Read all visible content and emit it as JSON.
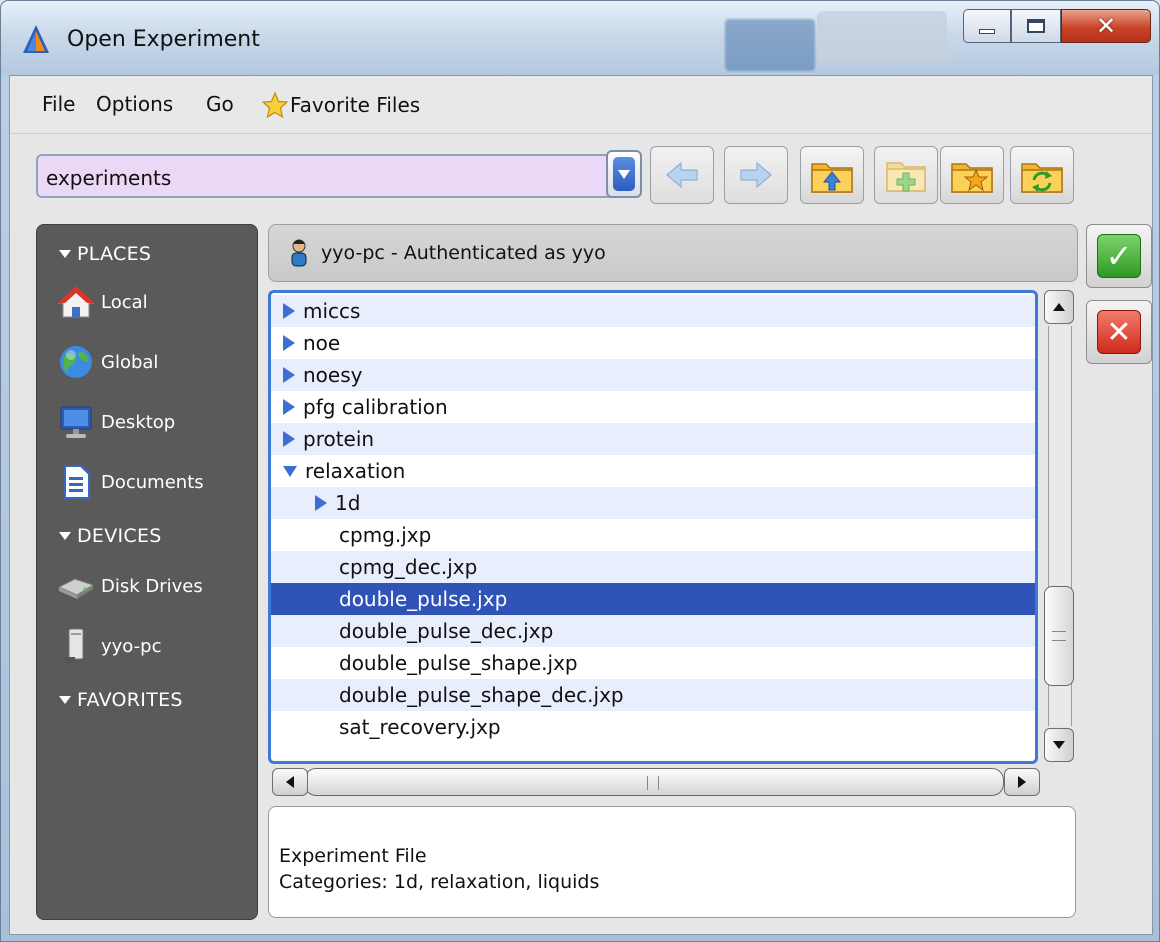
{
  "window": {
    "title": "Open Experiment",
    "accent_color": "#3f78d8",
    "selection_color": "#2f53b6",
    "path_bg_color": "#ead8f6"
  },
  "menu": {
    "file": "File",
    "options": "Options",
    "go": "Go",
    "favorite_files": "Favorite Files"
  },
  "toolbar": {
    "path_value": "experiments",
    "icons": [
      "dropdown-icon",
      "back-arrow-icon",
      "forward-arrow-icon",
      "folder-up-icon",
      "new-folder-icon",
      "favorite-folder-icon",
      "refresh-folder-icon"
    ]
  },
  "sidebar": {
    "places_header": "PLACES",
    "places": [
      {
        "label": "Local",
        "icon": "home-icon"
      },
      {
        "label": "Global",
        "icon": "globe-icon"
      },
      {
        "label": "Desktop",
        "icon": "monitor-icon"
      },
      {
        "label": "Documents",
        "icon": "document-icon"
      }
    ],
    "devices_header": "DEVICES",
    "devices": [
      {
        "label": "Disk Drives",
        "icon": "disk-drive-icon"
      },
      {
        "label": "yyo-pc",
        "icon": "computer-tower-icon"
      }
    ],
    "favorites_header": "FAVORITES"
  },
  "host": {
    "label": "yyo-pc - Authenticated as yyo"
  },
  "files": [
    {
      "name": "miccs",
      "type": "folder",
      "expanded": false,
      "depth": 0
    },
    {
      "name": "noe",
      "type": "folder",
      "expanded": false,
      "depth": 0
    },
    {
      "name": "noesy",
      "type": "folder",
      "expanded": false,
      "depth": 0
    },
    {
      "name": "pfg calibration",
      "type": "folder",
      "expanded": false,
      "depth": 0
    },
    {
      "name": "protein",
      "type": "folder",
      "expanded": false,
      "depth": 0
    },
    {
      "name": "relaxation",
      "type": "folder",
      "expanded": true,
      "depth": 0
    },
    {
      "name": "1d",
      "type": "folder",
      "expanded": false,
      "depth": 1
    },
    {
      "name": "cpmg.jxp",
      "type": "file",
      "depth": 1
    },
    {
      "name": "cpmg_dec.jxp",
      "type": "file",
      "depth": 1
    },
    {
      "name": "double_pulse.jxp",
      "type": "file",
      "depth": 1,
      "selected": true
    },
    {
      "name": "double_pulse_dec.jxp",
      "type": "file",
      "depth": 1
    },
    {
      "name": "double_pulse_shape.jxp",
      "type": "file",
      "depth": 1
    },
    {
      "name": "double_pulse_shape_dec.jxp",
      "type": "file",
      "depth": 1
    },
    {
      "name": "sat_recovery.jxp",
      "type": "file",
      "depth": 1
    }
  ],
  "info": {
    "line1": "Experiment File",
    "line2": "Categories: 1d, relaxation, liquids"
  }
}
